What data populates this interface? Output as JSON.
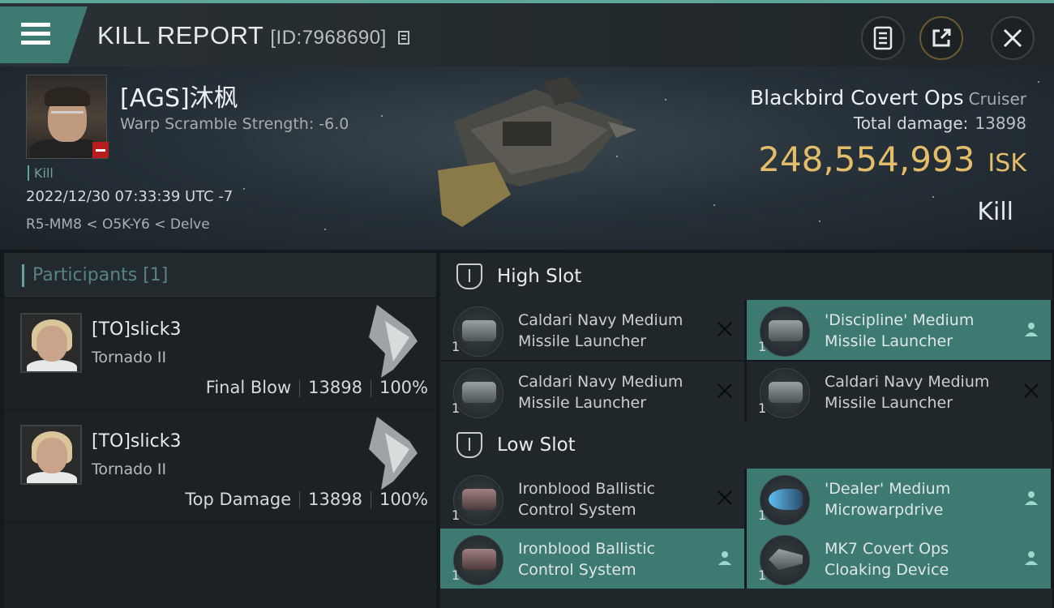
{
  "header": {
    "title": "KILL REPORT",
    "id_text": "[ID:7968690]"
  },
  "victim": {
    "name": "[AGS]沐枫",
    "warp_scramble": "Warp Scramble Strength: -6.0",
    "kill_tag": "Kill",
    "datetime": "2022/12/30 07:33:39 UTC -7",
    "location": "R5-MM8 < O5K-Y6 < Delve",
    "ship_name": "Blackbird Covert Ops",
    "ship_class": "Cruiser",
    "total_damage_label": "Total damage:",
    "total_damage": "13898",
    "isk_value": "248,554,993",
    "isk_unit": "ISK",
    "result": "Kill"
  },
  "participants": {
    "header": "Participants [1]",
    "items": [
      {
        "name": "[TO]slick3",
        "ship": "Tornado II",
        "role": "Final Blow",
        "damage": "13898",
        "percent": "100%"
      },
      {
        "name": "[TO]slick3",
        "ship": "Tornado II",
        "role": "Top Damage",
        "damage": "13898",
        "percent": "100%"
      }
    ]
  },
  "slots": {
    "high": {
      "label": "High Slot",
      "modules": [
        {
          "name": "Caldari Navy Medium Missile Launcher",
          "qty": "1",
          "state": "destroyed"
        },
        {
          "name": "'Discipline' Medium Missile Launcher",
          "qty": "1",
          "state": "dropped"
        },
        {
          "name": "Caldari Navy Medium Missile Launcher",
          "qty": "1",
          "state": "destroyed"
        },
        {
          "name": "Caldari Navy Medium Missile Launcher",
          "qty": "1",
          "state": "destroyed"
        }
      ]
    },
    "low": {
      "label": "Low Slot",
      "modules": [
        {
          "name": "Ironblood Ballistic Control System",
          "qty": "1",
          "state": "destroyed"
        },
        {
          "name": "'Dealer' Medium Microwarpdrive",
          "qty": "1",
          "state": "dropped"
        },
        {
          "name": "Ironblood Ballistic Control System",
          "qty": "1",
          "state": "dropped"
        },
        {
          "name": "MK7 Covert Ops Cloaking Device",
          "qty": "1",
          "state": "dropped"
        }
      ]
    }
  },
  "colors": {
    "accent": "#5fa59a",
    "dropped_bg": "#3d7a72",
    "isk": "#e3bd6a",
    "corp_badge": "#b61e1e"
  }
}
